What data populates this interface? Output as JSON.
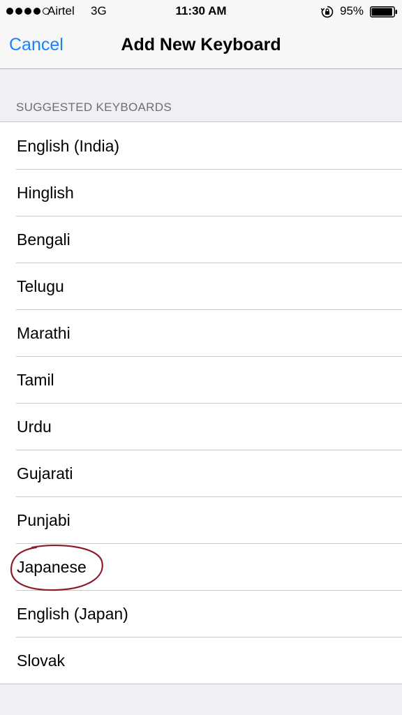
{
  "status_bar": {
    "carrier": "Airtel",
    "network": "3G",
    "time": "11:30 AM",
    "battery": "95%",
    "signal_bars_filled": 4,
    "signal_bars_total": 5,
    "battery_level": 0.95
  },
  "nav": {
    "cancel_label": "Cancel",
    "title": "Add New Keyboard"
  },
  "section": {
    "header": "SUGGESTED KEYBOARDS"
  },
  "keyboards": [
    {
      "label": "English (India)"
    },
    {
      "label": "Hinglish"
    },
    {
      "label": "Bengali"
    },
    {
      "label": "Telugu"
    },
    {
      "label": "Marathi"
    },
    {
      "label": "Tamil"
    },
    {
      "label": "Urdu"
    },
    {
      "label": "Gujarati"
    },
    {
      "label": "Punjabi"
    },
    {
      "label": "Japanese"
    },
    {
      "label": "English (Japan)"
    },
    {
      "label": "Slovak"
    }
  ],
  "colors": {
    "accent": "#1a82fb",
    "annotation": "#8b1c2c",
    "background": "#efeff4"
  },
  "icons": {
    "rotation_lock": "rotation-lock-icon",
    "battery": "battery-icon",
    "signal": "signal-strength-icon"
  }
}
